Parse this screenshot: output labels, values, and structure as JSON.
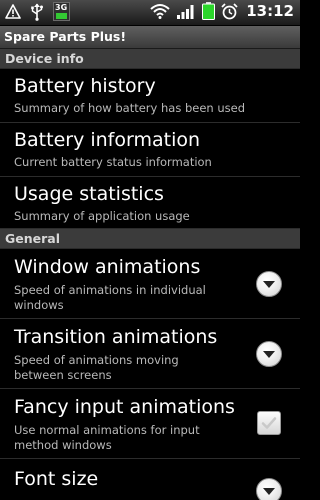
{
  "status_bar": {
    "time": "13:12",
    "network_type": "3G",
    "left_icons": [
      "warning-icon",
      "usb-icon"
    ],
    "right_icons": [
      "wifi-icon",
      "signal-icon",
      "battery-icon",
      "alarm-icon"
    ]
  },
  "app": {
    "title": "Spare Parts Plus!"
  },
  "sections": {
    "device_info": {
      "header": "Device info",
      "items": [
        {
          "title": "Battery history",
          "summary": "Summary of how battery has been used"
        },
        {
          "title": "Battery information",
          "summary": "Current battery status information"
        },
        {
          "title": "Usage statistics",
          "summary": "Summary of application usage"
        }
      ]
    },
    "general": {
      "header": "General",
      "items": [
        {
          "title": "Window animations",
          "summary": "Speed of animations in individual windows",
          "widget": "chevron-down-icon"
        },
        {
          "title": "Transition animations",
          "summary": "Speed of animations moving between screens",
          "widget": "chevron-down-icon"
        },
        {
          "title": "Fancy input animations",
          "summary": "Use normal animations for input method windows",
          "widget": "checkbox",
          "checked": false
        },
        {
          "title": "Font size",
          "widget": "chevron-down-icon"
        }
      ]
    }
  }
}
